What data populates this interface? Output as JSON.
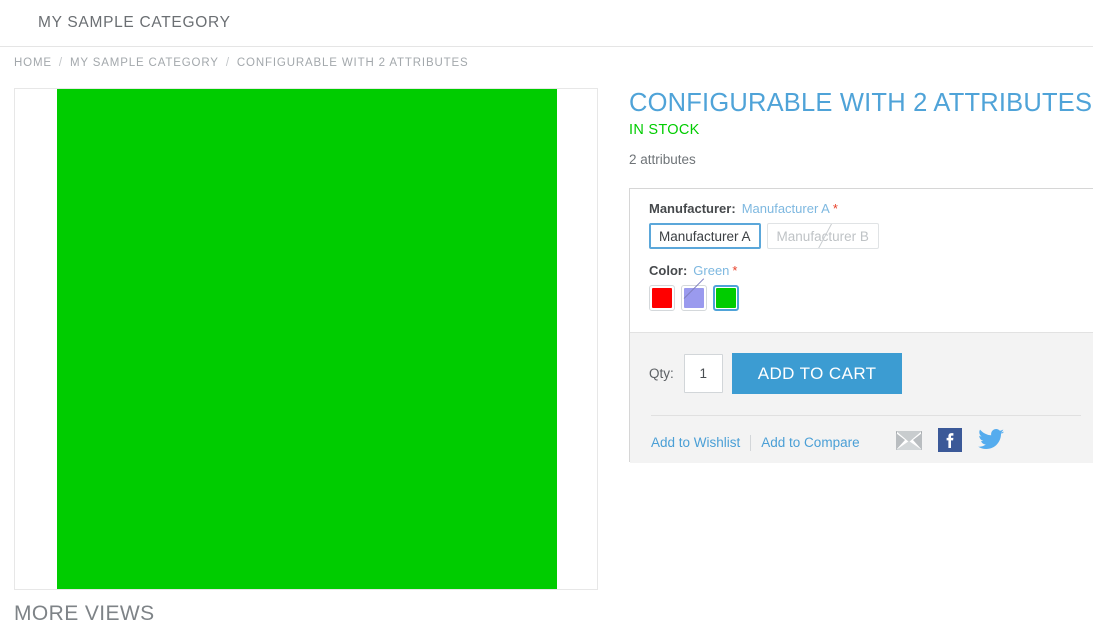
{
  "header": {
    "title": "MY SAMPLE CATEGORY"
  },
  "breadcrumbs": {
    "separator": "/",
    "items": [
      {
        "label": "HOME"
      },
      {
        "label": "MY SAMPLE CATEGORY"
      },
      {
        "label": "CONFIGURABLE WITH 2 ATTRIBUTES"
      }
    ]
  },
  "product": {
    "name": "CONFIGURABLE WITH 2 ATTRIBUTES",
    "availability": "IN STOCK",
    "short_description": "2 attributes",
    "image_color": "#00cc00",
    "more_views_title": "MORE VIEWS"
  },
  "options": [
    {
      "title": "Manufacturer:",
      "selected_value": "Manufacturer A",
      "required_mark": "*",
      "type": "text",
      "values": [
        {
          "label": "Manufacturer A",
          "selected": true,
          "disabled": false
        },
        {
          "label": "Manufacturer B",
          "selected": false,
          "disabled": true
        }
      ]
    },
    {
      "title": "Color:",
      "selected_value": "Green",
      "required_mark": "*",
      "type": "color",
      "values": [
        {
          "label": "Red",
          "color": "#ff0000",
          "selected": false,
          "disabled": false
        },
        {
          "label": "Purple",
          "color": "#9a9aee",
          "selected": false,
          "disabled": true
        },
        {
          "label": "Green",
          "color": "#00cc00",
          "selected": true,
          "disabled": false
        }
      ]
    }
  ],
  "cart": {
    "qty_label": "Qty:",
    "qty_value": "1",
    "add_to_cart_label": "ADD TO CART"
  },
  "links": {
    "wishlist": "Add to Wishlist",
    "compare": "Add to Compare"
  },
  "share": {
    "email_title": "Email",
    "facebook_title": "Facebook",
    "twitter_title": "Twitter"
  },
  "colors": {
    "accent": "#4fa3d8",
    "button": "#3c9cd2",
    "in_stock": "#00cc00",
    "required": "#e8412a",
    "facebook": "#3b5998",
    "twitter": "#55acee",
    "email": "#a6aaad"
  }
}
